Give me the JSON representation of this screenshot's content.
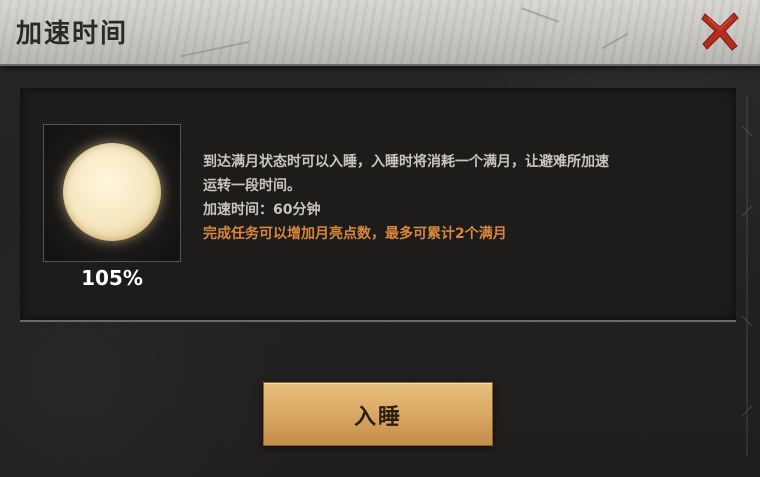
{
  "dialog": {
    "title": "加速时间",
    "close_icon": "close-x-icon",
    "accent_red": "#b32d1f"
  },
  "moon": {
    "icon": "full-moon-icon",
    "percent": "105%"
  },
  "description": {
    "line1": "到达满月状态时可以入睡，入睡时将消耗一个满月，让避难所加速",
    "line2": "运转一段时间。",
    "duration": "加速时间：60分钟",
    "hint": "完成任务可以增加月亮点数，最多可累计2个满月",
    "hint_color": "#d9873c"
  },
  "actions": {
    "sleep_label": "入睡"
  }
}
